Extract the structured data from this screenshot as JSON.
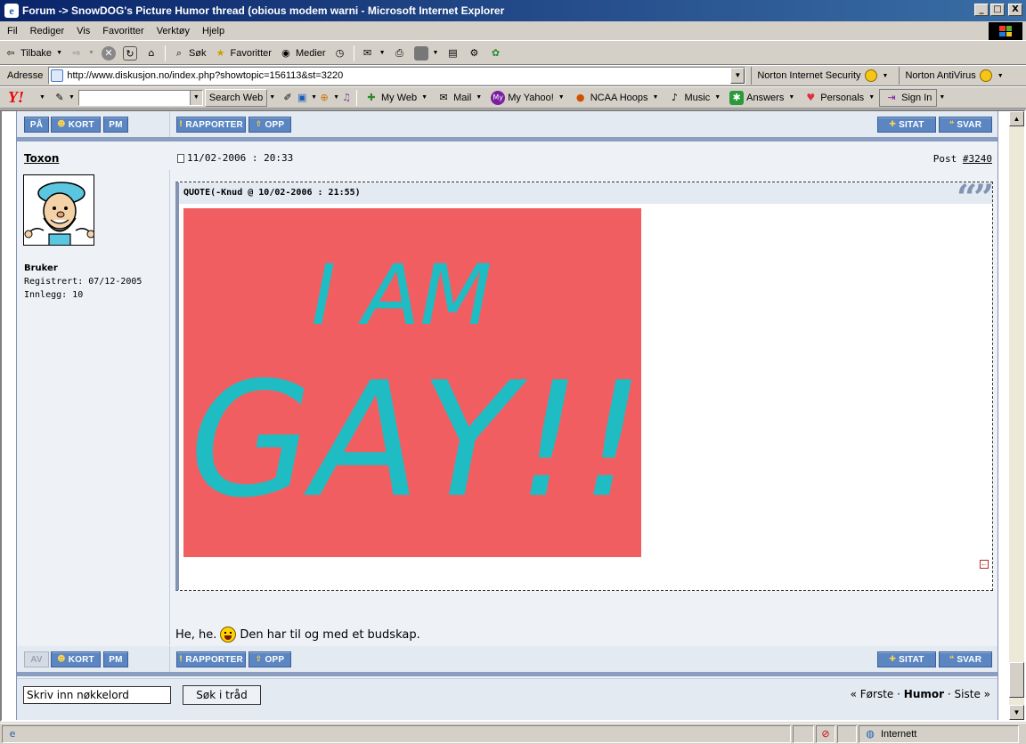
{
  "window": {
    "title": "Forum -> SnowDOG's Picture Humor thread (obious modem warni - Microsoft Internet Explorer",
    "minimize": "_",
    "maximize": "□",
    "close": "X"
  },
  "menu": [
    "Fil",
    "Rediger",
    "Vis",
    "Favoritter",
    "Verktøy",
    "Hjelp"
  ],
  "toolbar": {
    "back": "Tilbake",
    "search": "Søk",
    "favorites": "Favoritter",
    "media": "Medier"
  },
  "address": {
    "label": "Adresse",
    "url": "http://www.diskusjon.no/index.php?showtopic=156113&st=3220",
    "norton_security": "Norton Internet Security",
    "norton_antivirus": "Norton AntiVirus"
  },
  "yahoo": {
    "logo": "Y!",
    "search_web": "Search Web",
    "my_web": "My Web",
    "mail": "Mail",
    "my_yahoo": "My Yahoo!",
    "ncaa": "NCAA Hoops",
    "music": "Music",
    "answers": "Answers",
    "personals": "Personals",
    "sign_in": "Sign In"
  },
  "top_buttons": {
    "pa": "PÅ",
    "kort": "KORT",
    "pm": "PM",
    "rapporter": "RAPPORTER",
    "opp": "OPP",
    "sitat": "SITAT",
    "svar": "SVAR"
  },
  "post": {
    "author": "Toxon",
    "date": "11/02-2006 : 20:33",
    "post_label": "Post",
    "post_number": "#3240",
    "user_group": "Bruker",
    "registered": "Registrert: 07/12-2005",
    "posts": "Innlegg: 10",
    "quote_title": "QUOTE(-Knud @ 10/02-2006 : 21:55)",
    "image_text_line1": "I AM",
    "image_text_line2": "GAY!!",
    "text_before": "He, he.",
    "text_after": "Den har til og med et budskap."
  },
  "bottom_buttons": {
    "av": "AV",
    "kort": "KORT",
    "pm": "PM",
    "rapporter": "RAPPORTER",
    "opp": "OPP",
    "sitat": "SITAT",
    "svar": "SVAR"
  },
  "search": {
    "placeholder": "Skriv inn nøkkelord",
    "button": "Søk i tråd"
  },
  "nav": {
    "first": "« Første",
    "current": "Humor",
    "last": "Siste »",
    "dot": "·"
  },
  "status": {
    "zone": "Internett"
  },
  "colors": {
    "image_bg": "#f15e62",
    "image_text": "#1fbcc4",
    "button_blue": "#5b86c2"
  }
}
